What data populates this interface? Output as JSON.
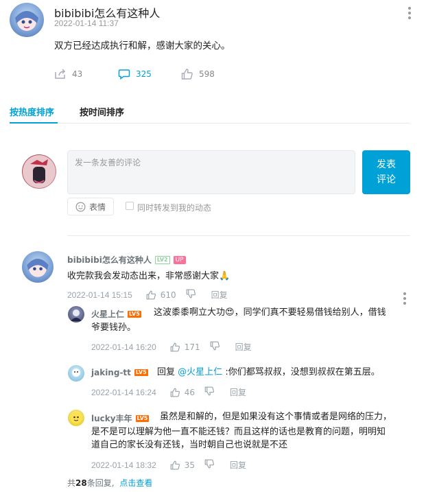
{
  "post": {
    "author": "bibibibi怎么有这种人",
    "time": "2022-01-14 11:37",
    "text": "双方已经达成执行和解，感谢大家的关心。",
    "shares": "43",
    "comments": "325",
    "likes": "598"
  },
  "tabs": {
    "hot": "按热度排序",
    "time": "按时间排序"
  },
  "composer": {
    "placeholder": "发一条友善的评论",
    "send_line1": "发表",
    "send_line2": "评论",
    "emoji_label": "表情",
    "forward_label": "同时转发到我的动态"
  },
  "comment": {
    "user": "bibibibi怎么有这种人",
    "level": "LV2",
    "up_badge": "UP",
    "text": "收完款我会发动态出来，非常感谢大家",
    "emoji": "🙏",
    "time": "2022-01-14 15:15",
    "likes": "610",
    "reply_label": "回复"
  },
  "replies": [
    {
      "user": "火星上仁",
      "level": "LV5",
      "text_before": "这波黍黍啊立大功",
      "emoji": "😍",
      "text_line1": "，同学们真不要轻易借钱给别人，借钱",
      "text_line2": "爷要钱孙。",
      "time": "2022-01-14 16:20",
      "likes": "171",
      "reply_label": "回复"
    },
    {
      "user": "jaking-tt",
      "level": "LV5",
      "reply_prefix": "回复",
      "mention": "@火星上仁",
      "text": ":你们都骂叔叔，没想到叔叔在第五层。",
      "time": "2022-01-14 16:24",
      "likes": "46",
      "reply_label": "回复"
    },
    {
      "user": "lucky丰年",
      "level": "LV5",
      "text_line1": "虽然是和解的，但是如果没有这个事情或者是网络的压力，",
      "text_line2": "是不是可以理解为他一直不能还钱？而且这样的话也是教育的问题，明明知",
      "text_line3": "道自己的家长没有还钱，当时朝自己也说就是不还",
      "time": "2022-01-14 18:32",
      "likes": "35",
      "reply_label": "回复"
    }
  ],
  "footer": {
    "prefix": "共",
    "count": "28",
    "suffix": "条回复,",
    "link": "点击查看"
  },
  "colors": {
    "accent": "#00a1d6",
    "up_pink": "#fb7299",
    "lv5": "#ff6c00",
    "lv2": "#8bd29b"
  }
}
